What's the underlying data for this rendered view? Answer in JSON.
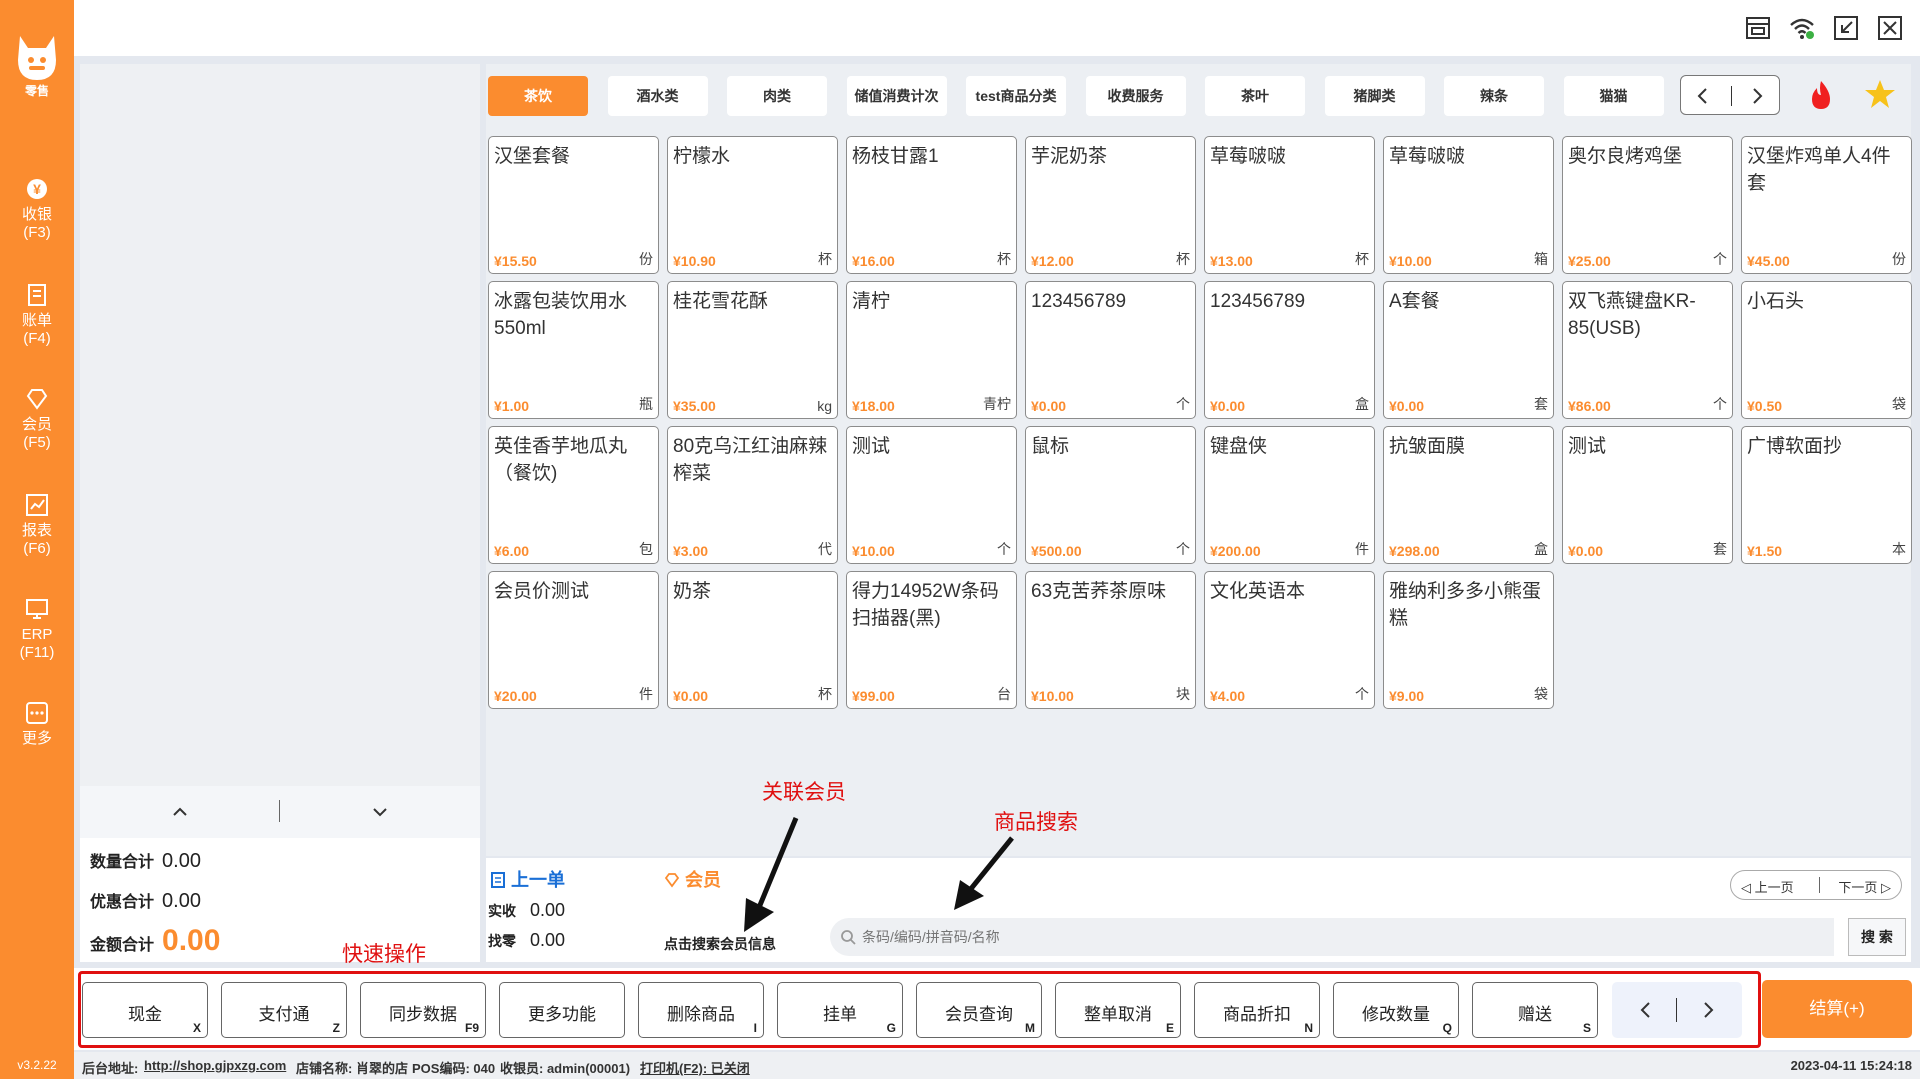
{
  "app": {
    "logo_text": "零售",
    "version": "v3.2.22"
  },
  "sidebar": [
    {
      "name": "收银",
      "key": "(F3)",
      "icon": "cashier-icon"
    },
    {
      "name": "账单",
      "key": "(F4)",
      "icon": "bill-icon"
    },
    {
      "name": "会员",
      "key": "(F5)",
      "icon": "member-icon"
    },
    {
      "name": "报表",
      "key": "(F6)",
      "icon": "report-icon"
    },
    {
      "name": "ERP",
      "key": "(F11)",
      "icon": "erp-icon"
    },
    {
      "name": "更多",
      "key": "",
      "icon": "more-icon"
    }
  ],
  "topbar": {
    "icons": [
      "store-icon",
      "wifi-icon",
      "minimize-icon",
      "close-icon"
    ]
  },
  "categories": {
    "active": 0,
    "items": [
      "茶饮",
      "酒水类",
      "肉类",
      "储值消费计次",
      "test商品分类",
      "收费服务",
      "茶叶",
      "猪脚类",
      "辣条",
      "猫猫"
    ]
  },
  "products": [
    {
      "name": "汉堡套餐",
      "price": "¥15.50",
      "unit": "份"
    },
    {
      "name": "柠檬水",
      "price": "¥10.90",
      "unit": "杯"
    },
    {
      "name": "杨枝甘露1",
      "price": "¥16.00",
      "unit": "杯"
    },
    {
      "name": "芋泥奶茶",
      "price": "¥12.00",
      "unit": "杯"
    },
    {
      "name": "草莓啵啵",
      "price": "¥13.00",
      "unit": "杯"
    },
    {
      "name": "草莓啵啵",
      "price": "¥10.00",
      "unit": "箱"
    },
    {
      "name": "奥尔良烤鸡堡",
      "price": "¥25.00",
      "unit": "个"
    },
    {
      "name": "汉堡炸鸡单人4件套",
      "price": "¥45.00",
      "unit": "份"
    },
    {
      "name": "冰露包装饮用水550ml",
      "price": "¥1.00",
      "unit": "瓶"
    },
    {
      "name": "桂花雪花酥",
      "price": "¥35.00",
      "unit": "kg"
    },
    {
      "name": "清柠",
      "price": "¥18.00",
      "unit": "青柠"
    },
    {
      "name": "123456789",
      "price": "¥0.00",
      "unit": "个"
    },
    {
      "name": "123456789",
      "price": "¥0.00",
      "unit": "盒"
    },
    {
      "name": "A套餐",
      "price": "¥0.00",
      "unit": "套"
    },
    {
      "name": "双飞燕键盘KR-85(USB)",
      "price": "¥86.00",
      "unit": "个"
    },
    {
      "name": "小石头",
      "price": "¥0.50",
      "unit": "袋"
    },
    {
      "name": "英佳香芋地瓜丸（餐饮)",
      "price": "¥6.00",
      "unit": "包"
    },
    {
      "name": "80克乌江红油麻辣榨菜",
      "price": "¥3.00",
      "unit": "代"
    },
    {
      "name": "测试",
      "price": "¥10.00",
      "unit": "个"
    },
    {
      "name": "鼠标",
      "price": "¥500.00",
      "unit": "个"
    },
    {
      "name": "键盘侠",
      "price": "¥200.00",
      "unit": "件"
    },
    {
      "name": "抗皱面膜",
      "price": "¥298.00",
      "unit": "盒"
    },
    {
      "name": "测试",
      "price": "¥0.00",
      "unit": "套"
    },
    {
      "name": "广博软面抄",
      "price": "¥1.50",
      "unit": "本"
    },
    {
      "name": "会员价测试",
      "price": "¥20.00",
      "unit": "件"
    },
    {
      "name": "奶茶",
      "price": "¥0.00",
      "unit": "杯"
    },
    {
      "name": "得力14952W条码扫描器(黑)",
      "price": "¥99.00",
      "unit": "台"
    },
    {
      "name": "63克苦荞茶原味",
      "price": "¥10.00",
      "unit": "块"
    },
    {
      "name": "文化英语本",
      "price": "¥4.00",
      "unit": "个"
    },
    {
      "name": "雅纳利多多小熊蛋糕",
      "price": "¥9.00",
      "unit": "袋"
    }
  ],
  "totals": {
    "qty_label": "数量合计",
    "qty": "0.00",
    "discount_label": "优惠合计",
    "discount": "0.00",
    "amount_label": "金额合计",
    "amount": "0.00"
  },
  "order": {
    "last_order": "上一单",
    "received_label": "实收",
    "received": "0.00",
    "change_label": "找零",
    "change": "0.00",
    "member_label": "会员",
    "member_hint": "点击搜索会员信息"
  },
  "pager": {
    "prev": "上一页",
    "next": "下一页"
  },
  "search": {
    "placeholder": "条码/编码/拼音码/名称",
    "button": "搜 索"
  },
  "annotations": {
    "member": "关联会员",
    "search": "商品搜索",
    "quick": "快速操作"
  },
  "quick_actions": [
    {
      "label": "现金",
      "key": "X"
    },
    {
      "label": "支付通",
      "key": "Z"
    },
    {
      "label": "同步数据",
      "key": "F9"
    },
    {
      "label": "更多功能",
      "key": ""
    },
    {
      "label": "删除商品",
      "key": "I"
    },
    {
      "label": "挂单",
      "key": "G"
    },
    {
      "label": "会员查询",
      "key": "M"
    },
    {
      "label": "整单取消",
      "key": "E"
    },
    {
      "label": "商品折扣",
      "key": "N"
    },
    {
      "label": "修改数量",
      "key": "Q"
    },
    {
      "label": "赠送",
      "key": "S"
    }
  ],
  "checkout": {
    "label": "结算(+)"
  },
  "status": {
    "backend_label": "后台地址:",
    "backend_url": "http://shop.gjpxzg.com",
    "store": "店铺名称: 肖翠的店",
    "pos": "POS编码: 040",
    "cashier": "收银员: admin(00001)",
    "printer": "打印机(F2): 已关闭",
    "datetime": "2023-04-11 15:24:18"
  },
  "colors": {
    "accent": "#fb8c2f",
    "annotation": "#e01010",
    "link": "#1a6fd6"
  }
}
